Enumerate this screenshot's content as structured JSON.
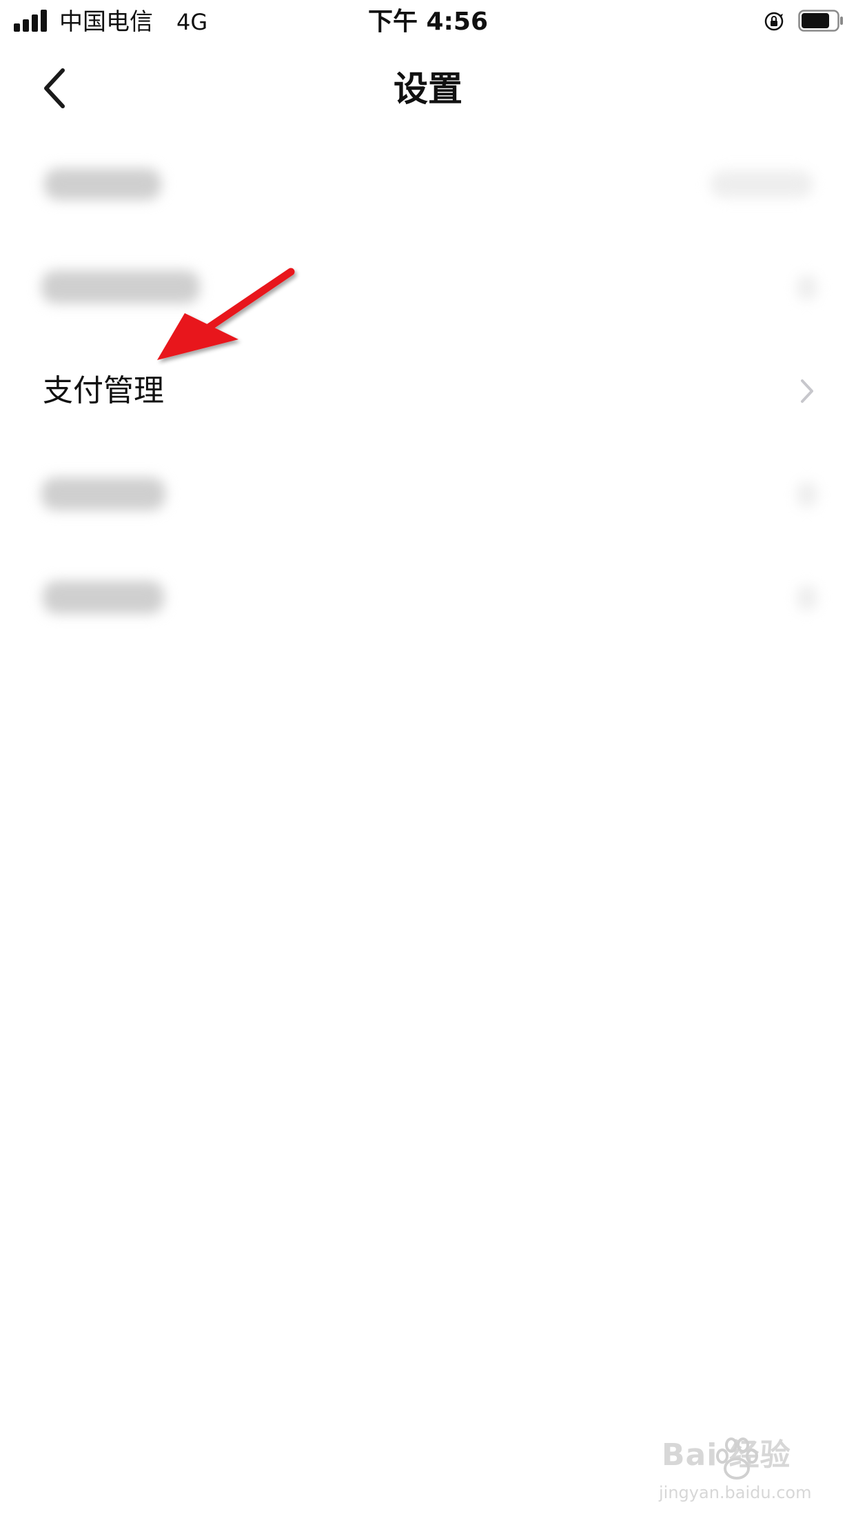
{
  "status_bar": {
    "carrier": "中国电信",
    "network": "4G",
    "time": "下午 4:56",
    "battery_level": 0.8
  },
  "nav": {
    "title": "设置"
  },
  "settings": {
    "items": [
      {
        "label": "",
        "blurred": true
      },
      {
        "label": "",
        "blurred": true
      },
      {
        "label": "支付管理",
        "blurred": false
      },
      {
        "label": "",
        "blurred": true
      },
      {
        "label": "",
        "blurred": true
      }
    ]
  },
  "annotation": {
    "arrow_color": "#e8191c"
  },
  "watermark": {
    "logo": "Bai  经验",
    "url": "jingyan.baidu.com"
  }
}
